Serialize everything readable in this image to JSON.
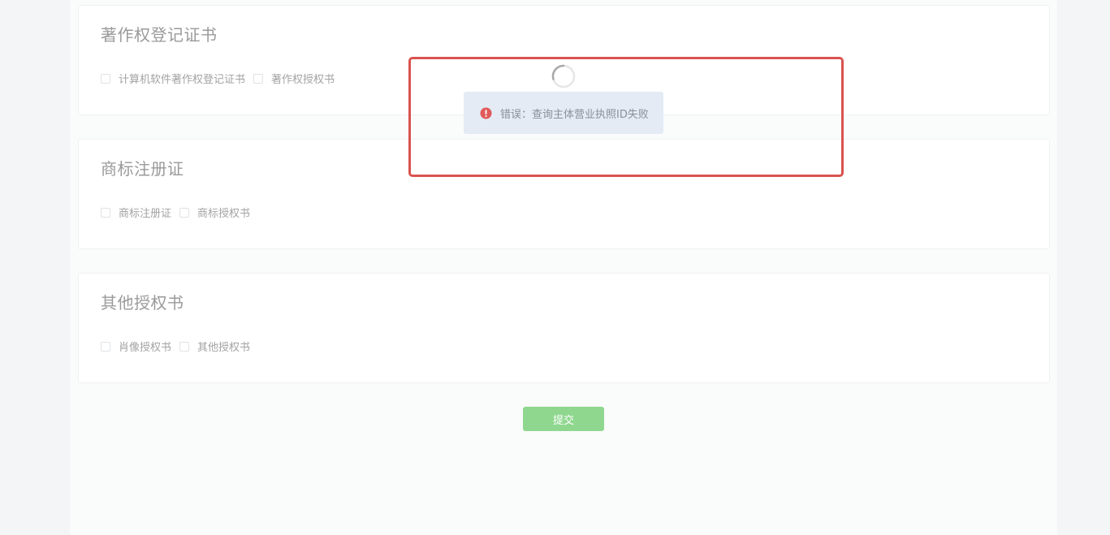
{
  "sections": [
    {
      "title": "著作权登记证书",
      "options": [
        "计算机软件著作权登记证书",
        "著作权授权书"
      ]
    },
    {
      "title": "商标注册证",
      "options": [
        "商标注册证",
        "商标授权书"
      ]
    },
    {
      "title": "其他授权书",
      "options": [
        "肖像授权书",
        "其他授权书"
      ]
    }
  ],
  "submit_label": "提交",
  "toast": {
    "message": "错误：查询主体营业执照ID失败",
    "icon": "error-icon"
  },
  "colors": {
    "highlight": "#d9534f",
    "submit": "#8fd78f",
    "error": "#e05a5a",
    "toast_bg": "#e4ebf5"
  }
}
